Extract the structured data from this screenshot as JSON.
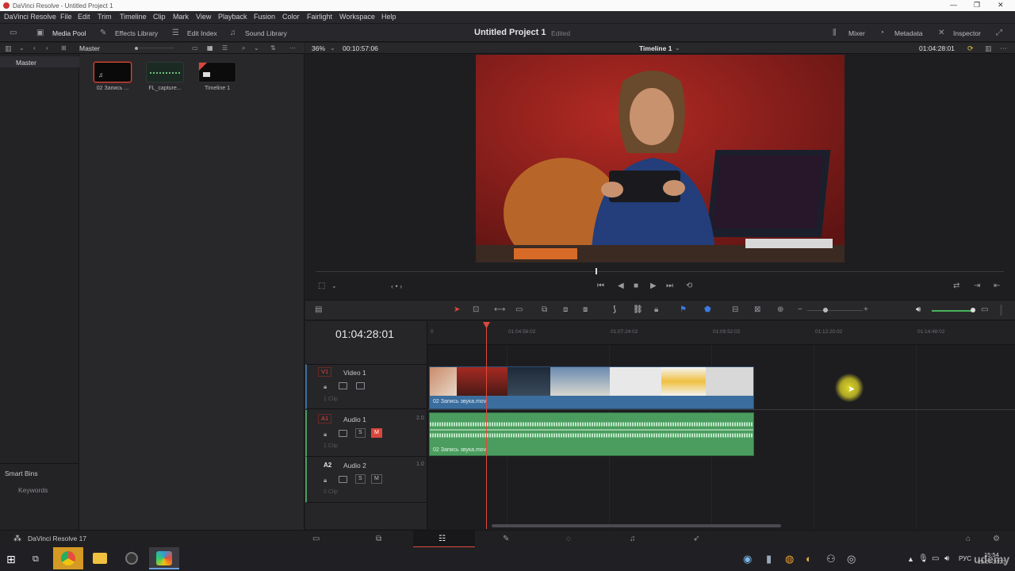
{
  "window": {
    "title": "DaVinci Resolve - Untitled Project 1"
  },
  "menu": [
    "DaVinci Resolve",
    "File",
    "Edit",
    "Trim",
    "Timeline",
    "Clip",
    "Mark",
    "View",
    "Playback",
    "Fusion",
    "Color",
    "Fairlight",
    "Workspace",
    "Help"
  ],
  "toolbar": {
    "media_pool": "Media Pool",
    "effects_library": "Effects Library",
    "edit_index": "Edit Index",
    "sound_library": "Sound Library",
    "project_title": "Untitled Project 1",
    "project_status": "Edited",
    "mixer": "Mixer",
    "metadata": "Metadata",
    "inspector": "Inspector"
  },
  "bins": {
    "header": "Master",
    "items": [
      "Master"
    ],
    "smart_bins": "Smart Bins",
    "keywords": "Keywords"
  },
  "media_pool": {
    "header": "Master",
    "clips": [
      {
        "label": "02 Запись ..."
      },
      {
        "label": "FL_capture..."
      },
      {
        "label": "Timeline 1"
      }
    ]
  },
  "viewer": {
    "zoom": "36%",
    "source_timecode": "00:10:57:06",
    "timeline_name": "Timeline 1",
    "record_timecode": "01:04:28:01"
  },
  "timeline": {
    "current_timecode": "01:04:28:01",
    "ruler_ticks": [
      "01:04:56:02",
      "01:07:24:02",
      "01:09:52:02",
      "01:12:20:02",
      "01:14:48:02"
    ],
    "tracks": [
      {
        "id": "V1",
        "name": "Video 1",
        "count": "1 Clip",
        "clip_label": "02 Запись звука.mov"
      },
      {
        "id": "A1",
        "name": "Audio 1",
        "channels": "2.0",
        "count": "1 Clip",
        "clip_label": "02 Запись звука.mov",
        "solo": "S",
        "mute": "M"
      },
      {
        "id": "A2",
        "name": "Audio 2",
        "channels": "1.0",
        "count": "0 Clip",
        "solo": "S",
        "mute": "M"
      }
    ]
  },
  "pagebar": {
    "app_label": "DaVinci Resolve 17"
  },
  "taskbar": {
    "lang": "РУС",
    "time": "15:54",
    "date": "23.07.2021",
    "watermark": "udemy"
  },
  "colors": {
    "accent_red": "#e0493a",
    "video_clip": "#3b6e9e",
    "audio_clip": "#4a9d5e",
    "mute_active": "#d9463b"
  }
}
